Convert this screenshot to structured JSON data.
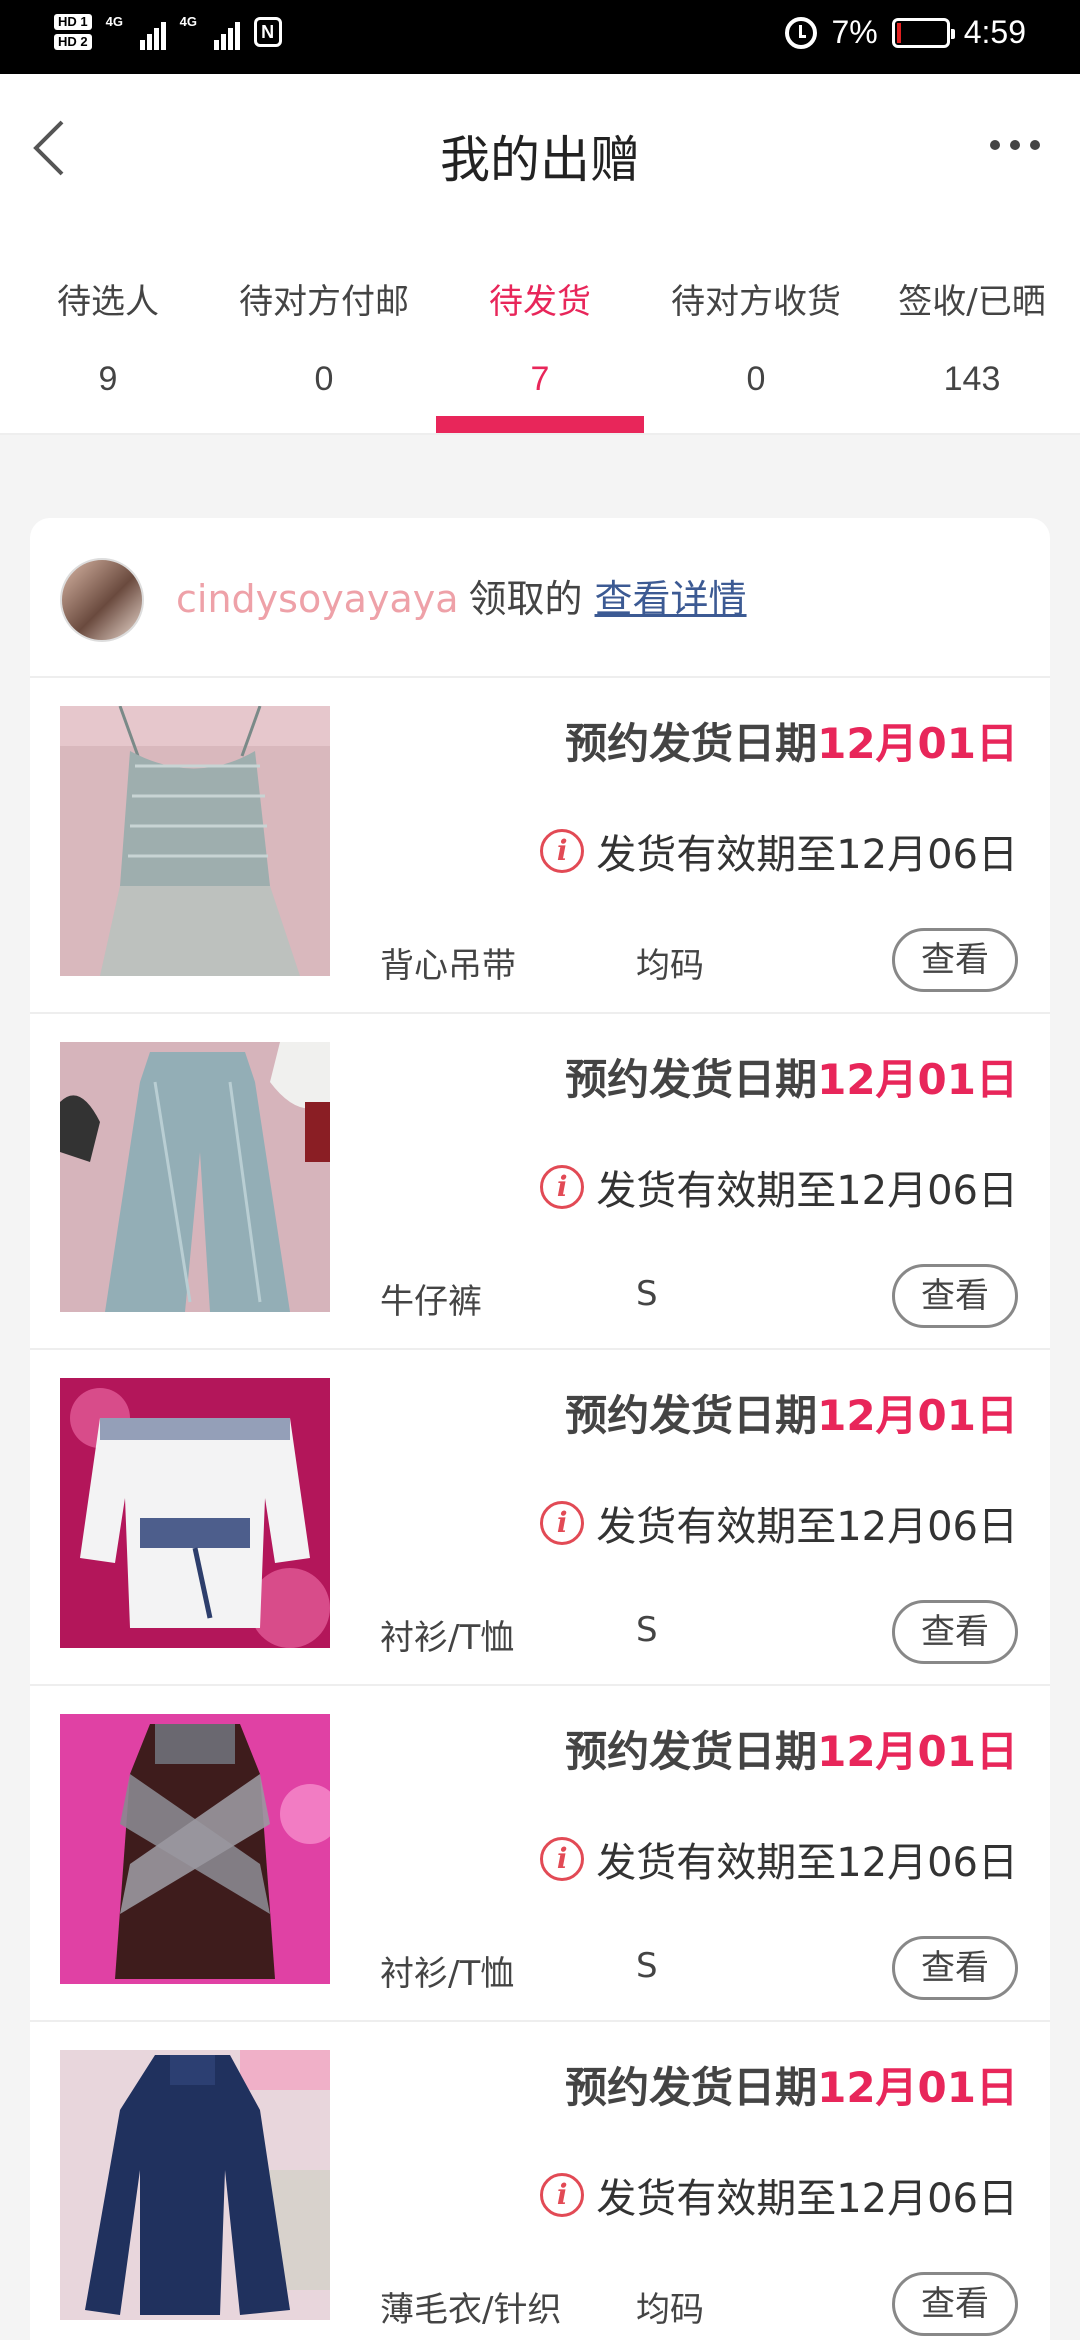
{
  "status_bar": {
    "hd1": "HD 1",
    "hd2": "HD 2",
    "sig1": "4G",
    "sig2": "4G",
    "nfc": "N",
    "battery": "7%",
    "battery_level": 0.07,
    "time": "4:59",
    "icons": [
      "alarm-icon",
      "battery-icon",
      "nfc-icon",
      "signal-icon"
    ]
  },
  "header": {
    "title": "我的出赠",
    "back_icon": "chevron-left-icon",
    "more_icon": "more-horizontal-icon"
  },
  "tabs": [
    {
      "label": "待选人",
      "count": "9"
    },
    {
      "label": "待对方付邮",
      "count": "0"
    },
    {
      "label": "待发货",
      "count": "7"
    },
    {
      "label": "待对方收货",
      "count": "0"
    },
    {
      "label": "签收/已晒",
      "count": "143"
    }
  ],
  "active_tab": 2,
  "colors": {
    "accent": "#e8265a",
    "username": "#eea1a8",
    "link": "#3c5a93",
    "info": "#e24a55"
  },
  "card": {
    "username": "cindysoyayaya",
    "action": "领取的",
    "link": "查看详情",
    "items": [
      {
        "reserve_label": "预约发货日期",
        "reserve_date": "12月01日",
        "validity": "发货有效期至12月06日",
        "category": "背心吊带",
        "size": "均码",
        "button": "查看",
        "photo": "grey sequin camisole top"
      },
      {
        "reserve_label": "预约发货日期",
        "reserve_date": "12月01日",
        "validity": "发货有效期至12月06日",
        "category": "牛仔裤",
        "size": "S",
        "button": "查看",
        "photo": "light blue flared jeans"
      },
      {
        "reserve_label": "预约发货日期",
        "reserve_date": "12月01日",
        "validity": "发货有效期至12月06日",
        "category": "衬衫/T恤",
        "size": "S",
        "button": "查看",
        "photo": "white off-shoulder blouse"
      },
      {
        "reserve_label": "预约发货日期",
        "reserve_date": "12月01日",
        "validity": "发货有效期至12月06日",
        "category": "衬衫/T恤",
        "size": "S",
        "button": "查看",
        "photo": "dark velvet long-sleeve top"
      },
      {
        "reserve_label": "预约发货日期",
        "reserve_date": "12月01日",
        "validity": "发货有效期至12月06日",
        "category": "薄毛衣/针织",
        "size": "均码",
        "button": "查看",
        "photo": "navy knit sweater"
      }
    ]
  }
}
